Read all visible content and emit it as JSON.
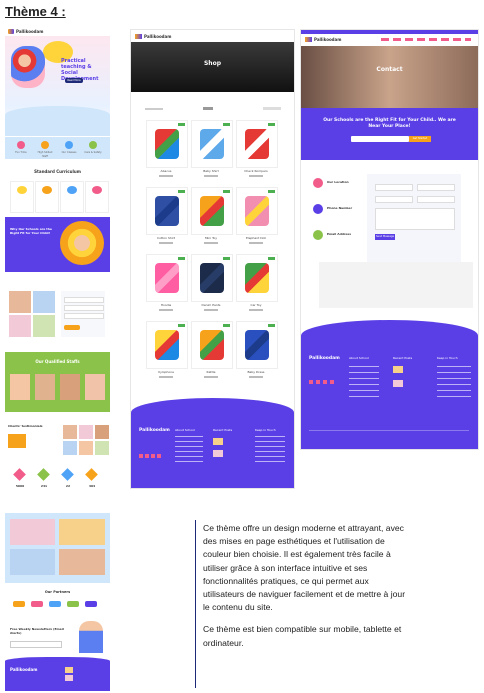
{
  "page_title": "Thème 4 :",
  "description": {
    "paragraph1": "Ce thème offre un design moderne et attrayant, avec des mises en page esthétiques et l'utilisation de couleur bien choisie. Il est également très facile à utiliser grâce à son interface intuitive et ses fonctionnalités pratiques, ce qui permet aux utilisateurs de naviguer facilement et de mettre à jour le contenu du site.",
    "paragraph2": "Ce thème est bien compatible sur mobile, tablette et ordinateur."
  },
  "brand": "Pallikoodam",
  "home": {
    "hero_title": "Practical teaching & Social Development",
    "hero_button": "Read More",
    "features": [
      "Fun Time",
      "High Skilled Staff",
      "Our Classes",
      "Care & Safety"
    ],
    "curriculum_title": "Standard Curriculum",
    "why_title": "Why Our Schools are the Right Fit for Your Child!",
    "qualified_title": "Our Qualified Staffs",
    "testimonials_title": "Clients' testimonials",
    "stats_values": [
      "5000",
      "241",
      "22",
      "404"
    ],
    "partners_title": "Our Partners",
    "newsletter_title": "Free Weekly Newsletters (Email Alerts)"
  },
  "shop": {
    "banner_title": "Shop",
    "products": [
      "Abacus",
      "Baby Shirt",
      "Check Rompers",
      "Cotton Shirt",
      "Mini Toy",
      "Elephant Doll",
      "Hoodie",
      "Denim Pants",
      "Car Toy",
      "Xylophone",
      "Rattle",
      "Baby Dress"
    ],
    "footer_sections": [
      "About School",
      "Recent Posts",
      "Keep in Touch"
    ]
  },
  "contact": {
    "banner_title": "Contact",
    "headline": "Our Schools are the Right Fit for Your Child.. We are Near Your Place!",
    "cta_button": "Get Started",
    "info": [
      "Our Location",
      "Phone Number",
      "Email Address"
    ],
    "send_button": "Send Message",
    "footer_sections": [
      "About School",
      "Recent Posts",
      "Keep in Touch"
    ]
  },
  "colors": {
    "purple": "#5b3fe6",
    "green": "#8bc34a",
    "orange": "#f7a21b",
    "pink": "#f25c8a",
    "dark": "#1e2a78"
  }
}
